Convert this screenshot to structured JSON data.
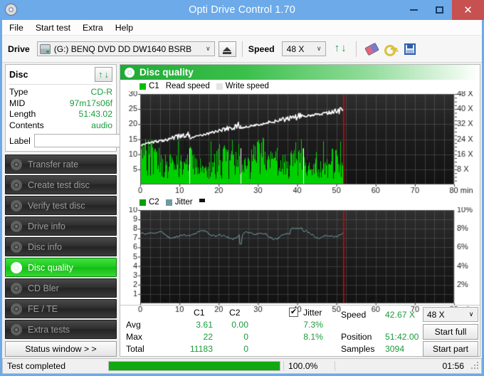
{
  "window": {
    "title": "Opti Drive Control 1.70",
    "icon": "disc-icon",
    "minimize": "–",
    "maximize": "▢",
    "close": "✕"
  },
  "menu": {
    "items": [
      "File",
      "Start test",
      "Extra",
      "Help"
    ]
  },
  "toolbar": {
    "drive_label": "Drive",
    "drive_value": "(G:)  BENQ DVD DD DW1640 BSRB",
    "eject_icon": "eject-icon",
    "speed_label": "Speed",
    "speed_value": "48 X",
    "swap_icon": "refresh-swap-icon",
    "erase_icon": "erase-icon",
    "key_icon": "key-icon",
    "save_icon": "save-icon"
  },
  "sidebar": {
    "disc_panel": {
      "title": "Disc",
      "refresh_icon": "refresh-icon",
      "rows": [
        {
          "key": "Type",
          "value": "CD-R"
        },
        {
          "key": "MID",
          "value": "97m17s06f"
        },
        {
          "key": "Length",
          "value": "51:43.02"
        },
        {
          "key": "Contents",
          "value": "audio"
        }
      ],
      "label_key": "Label",
      "label_value": "",
      "label_placeholder": "",
      "cd_icon": "cd-disc-icon"
    },
    "nav_items": [
      {
        "label": "Transfer rate",
        "active": false
      },
      {
        "label": "Create test disc",
        "active": false
      },
      {
        "label": "Verify test disc",
        "active": false
      },
      {
        "label": "Drive info",
        "active": false
      },
      {
        "label": "Disc info",
        "active": false
      },
      {
        "label": "Disc quality",
        "active": true
      },
      {
        "label": "CD Bler",
        "active": false
      },
      {
        "label": "FE / TE",
        "active": false
      },
      {
        "label": "Extra tests",
        "active": false
      }
    ],
    "status_window_button": "Status window > >"
  },
  "main": {
    "header": "Disc quality",
    "header_icon": "disc-quality-icon"
  },
  "stats": {
    "col_c1": "C1",
    "col_c2": "C2",
    "jitter_label": "Jitter",
    "jitter_checked": true,
    "rows": [
      {
        "name": "Avg",
        "c1": "3.61",
        "c2": "0.00",
        "jitter": "7.3%"
      },
      {
        "name": "Max",
        "c1": "22",
        "c2": "0",
        "jitter": "8.1%"
      },
      {
        "name": "Total",
        "c1": "11183",
        "c2": "0",
        "jitter": ""
      }
    ],
    "speed_label": "Speed",
    "speed_value": "42.67 X",
    "position_label": "Position",
    "position_value": "51:42.00",
    "samples_label": "Samples",
    "samples_value": "3094",
    "speed_select": "48 X",
    "start_full": "Start full",
    "start_part": "Start part"
  },
  "statusbar": {
    "text": "Test completed",
    "progress_percent": 100,
    "percent_label": "100.0%",
    "time": "01:56"
  },
  "colors": {
    "accent_green": "#1a9b3c",
    "plot_bg": "#1c1c1c",
    "c1_bar": "#00d000",
    "read_speed_line": "#ffffff",
    "jitter_line": "#6f9aa0",
    "marker_red": "#e00000",
    "titlebar": "#6caaea",
    "close_button": "#c75050"
  },
  "chart_data": [
    {
      "type": "bar",
      "id": "c1-chart",
      "title": "",
      "legend": [
        {
          "label": "C1",
          "color": "#00c000",
          "swatch": true
        },
        {
          "label": "Read speed",
          "color": "#ffffff",
          "swatch": false
        },
        {
          "label": "Write speed",
          "color": "#e8e8e8",
          "swatch": true
        }
      ],
      "xlabel": "min",
      "x_ticks": [
        0,
        10,
        20,
        30,
        40,
        50,
        60,
        70,
        80
      ],
      "xlim": [
        0,
        80
      ],
      "ylabel_left": "",
      "y_ticks_left": [
        5,
        10,
        15,
        20,
        25,
        30
      ],
      "ylim_left": [
        0,
        30
      ],
      "ylabel_right": "X",
      "y_ticks_right": [
        "8 X",
        "16 X",
        "24 X",
        "32 X",
        "40 X",
        "48 X"
      ],
      "ylim_right": [
        0,
        48
      ],
      "data_end_min": 51.7,
      "marker_min": 51.7,
      "grid": true,
      "c1_mean": 3.61,
      "c1_max": 22,
      "c1_total": 11183,
      "read_speed_segments": [
        {
          "from_min": 0,
          "to_min": 12.6,
          "start_x": 21.0,
          "end_x": 26.5
        },
        {
          "from_min": 12.6,
          "to_min": 25.6,
          "start_x": 24.5,
          "end_x": 31.5
        },
        {
          "from_min": 25.6,
          "to_min": 41.6,
          "start_x": 30.0,
          "end_x": 36.5
        },
        {
          "from_min": 41.6,
          "to_min": 51.7,
          "start_x": 36.0,
          "end_x": 39.5
        }
      ]
    },
    {
      "type": "line",
      "id": "c2-jitter-chart",
      "title": "",
      "legend": [
        {
          "label": "C2",
          "color": "#00a000",
          "swatch": true
        },
        {
          "label": "Jitter",
          "color": "#6f9aa0",
          "swatch": true
        }
      ],
      "xlabel": "min",
      "x_ticks": [
        0,
        10,
        20,
        30,
        40,
        50,
        60,
        70,
        80
      ],
      "xlim": [
        0,
        80
      ],
      "y_ticks_left": [
        1,
        2,
        3,
        4,
        5,
        6,
        7,
        8,
        9,
        10
      ],
      "ylim_left": [
        0,
        10
      ],
      "y_ticks_right": [
        "2%",
        "4%",
        "6%",
        "8%",
        "10%"
      ],
      "ylim_right": [
        0,
        10
      ],
      "data_end_min": 51.7,
      "marker_min": 51.7,
      "grid": true,
      "jitter_avg_pct": 7.3,
      "jitter_max_pct": 8.1,
      "c2_avg": 0.0,
      "c2_max": 0,
      "c2_total": 0
    }
  ]
}
